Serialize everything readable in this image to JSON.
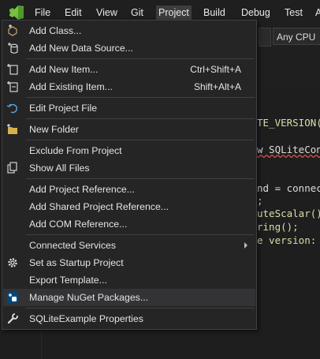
{
  "menubar": {
    "items": [
      "File",
      "Edit",
      "View",
      "Git",
      "Project",
      "Build",
      "Debug",
      "Test",
      "A"
    ],
    "active_index": 4
  },
  "toolbar": {
    "platform": "Any CPU"
  },
  "code": {
    "lines": [
      {
        "text": "TE_VERSION("
      },
      {
        "text": "w SQLiteCon"
      },
      {
        "text": "nd = connec"
      },
      {
        "text": ";"
      },
      {
        "text": "uteScalar()"
      },
      {
        "text": "ring();"
      },
      {
        "text": "e version: "
      }
    ]
  },
  "context_menu": {
    "items": [
      {
        "label": "Add Class...",
        "icon": "add-class-icon"
      },
      {
        "label": "Add New Data Source...",
        "icon": "add-data-source-icon"
      },
      {
        "label": "Add New Item...",
        "shortcut": "Ctrl+Shift+A",
        "icon": "new-item-icon"
      },
      {
        "label": "Add Existing Item...",
        "shortcut": "Shift+Alt+A",
        "icon": "existing-item-icon"
      },
      {
        "label": "Edit Project File",
        "icon": "edit-file-icon"
      },
      {
        "label": "New Folder",
        "icon": "folder-icon"
      },
      {
        "label": "Exclude From Project"
      },
      {
        "label": "Show All Files",
        "icon": "show-all-files-icon"
      },
      {
        "label": "Add Project Reference..."
      },
      {
        "label": "Add Shared Project Reference..."
      },
      {
        "label": "Add COM Reference..."
      },
      {
        "label": "Connected Services"
      },
      {
        "label": "Set as Startup Project",
        "icon": "gear-icon"
      },
      {
        "label": "Export Template..."
      },
      {
        "label": "Manage NuGet Packages...",
        "icon": "nuget-icon"
      },
      {
        "label": "SQLiteExample Properties",
        "icon": "wrench-icon"
      }
    ]
  },
  "colors": {
    "menu_bg": "#252526",
    "highlight": "#333336",
    "logo": "#7bc043"
  }
}
